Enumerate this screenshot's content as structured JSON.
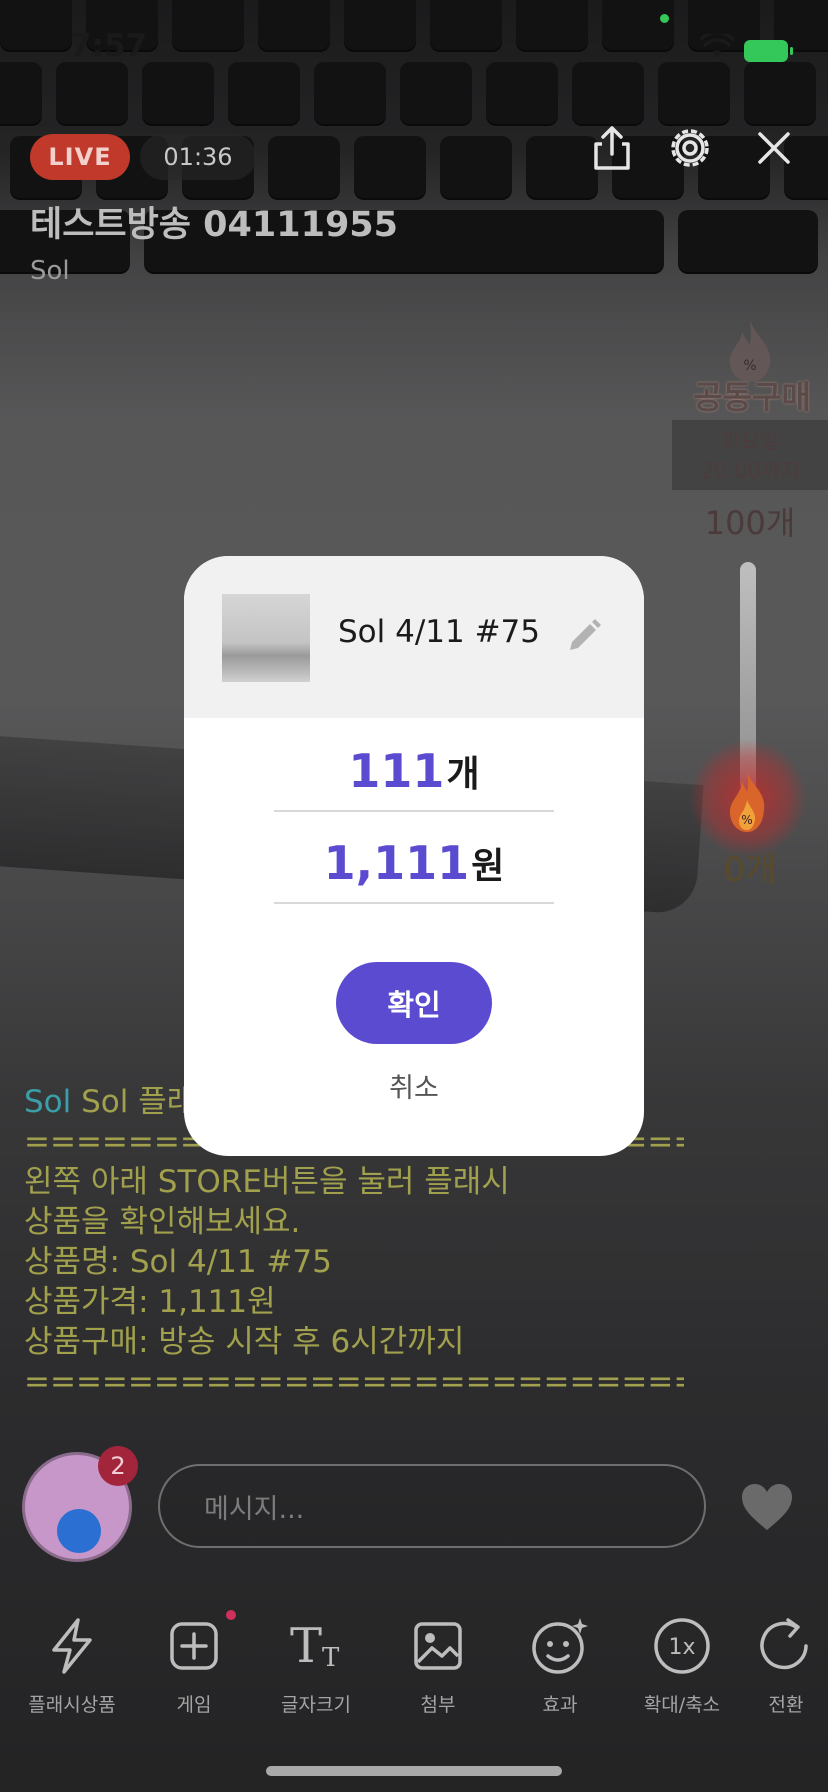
{
  "status_bar": {
    "time": "7:57"
  },
  "stream": {
    "live_label": "LIVE",
    "elapsed": "01:36",
    "title": "테스트방송 04111955",
    "host": "Sol"
  },
  "group_buy": {
    "label": "공동구매",
    "deadline_line1": "화요일",
    "deadline_line2": "20:00까지",
    "target": "100개",
    "current": "0개",
    "progress": 0,
    "accent_color": "#d22828"
  },
  "chat": {
    "author": "Sol",
    "first_line": "Sol 플래시상품을 등록했어요.",
    "lines": [
      "==================================",
      "왼쪽 아래 STORE버튼을 눌러 플래시",
      "상품을 확인해보세요.",
      "상품명: Sol 4/11 #75",
      "상품가격: 1,111원",
      "상품구매: 방송 시작 후 6시간까지",
      "=================================="
    ]
  },
  "viewer": {
    "badge_count": "2"
  },
  "message_input": {
    "placeholder": "메시지..."
  },
  "toolbar": {
    "items": [
      {
        "label": "플래시상품",
        "icon": "lightning-icon"
      },
      {
        "label": "게임",
        "icon": "plus-square-icon"
      },
      {
        "label": "글자크기",
        "icon": "text-size-icon"
      },
      {
        "label": "첨부",
        "icon": "image-icon"
      },
      {
        "label": "효과",
        "icon": "smile-sparkle-icon"
      },
      {
        "label": "확대/축소",
        "icon": "zoom-1x-icon"
      },
      {
        "label": "전환",
        "icon": "rotate-icon"
      }
    ]
  },
  "modal": {
    "product_name": "Sol 4/11 #75",
    "quantity": "111",
    "quantity_unit": "개",
    "price": "1,111",
    "price_unit": "원",
    "confirm_label": "확인",
    "cancel_label": "취소",
    "accent_color": "#5b4bd0"
  }
}
